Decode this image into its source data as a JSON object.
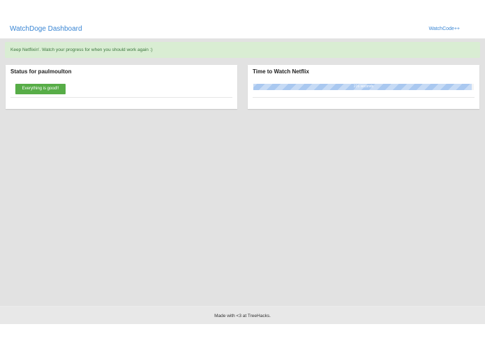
{
  "navbar": {
    "brand": "WatchDoge Dashboard",
    "link": "WatchCode++"
  },
  "alert": {
    "message": "Keep Netflixin'. Watch your progress for when you should work again :)"
  },
  "status_card": {
    "title": "Status for paulmoulton",
    "button_label": "Everything is good!!"
  },
  "netflix_card": {
    "title": "Time to Watch Netflix",
    "progress_label": "226 seconds",
    "progress_fraction": 0.99
  },
  "footer": {
    "text": "Made with <3 at TreeHacks."
  },
  "colors": {
    "accent": "#3a86d4",
    "success": "#57ad47",
    "progress": "#a9c8f0",
    "background": "#e2e2e2"
  }
}
